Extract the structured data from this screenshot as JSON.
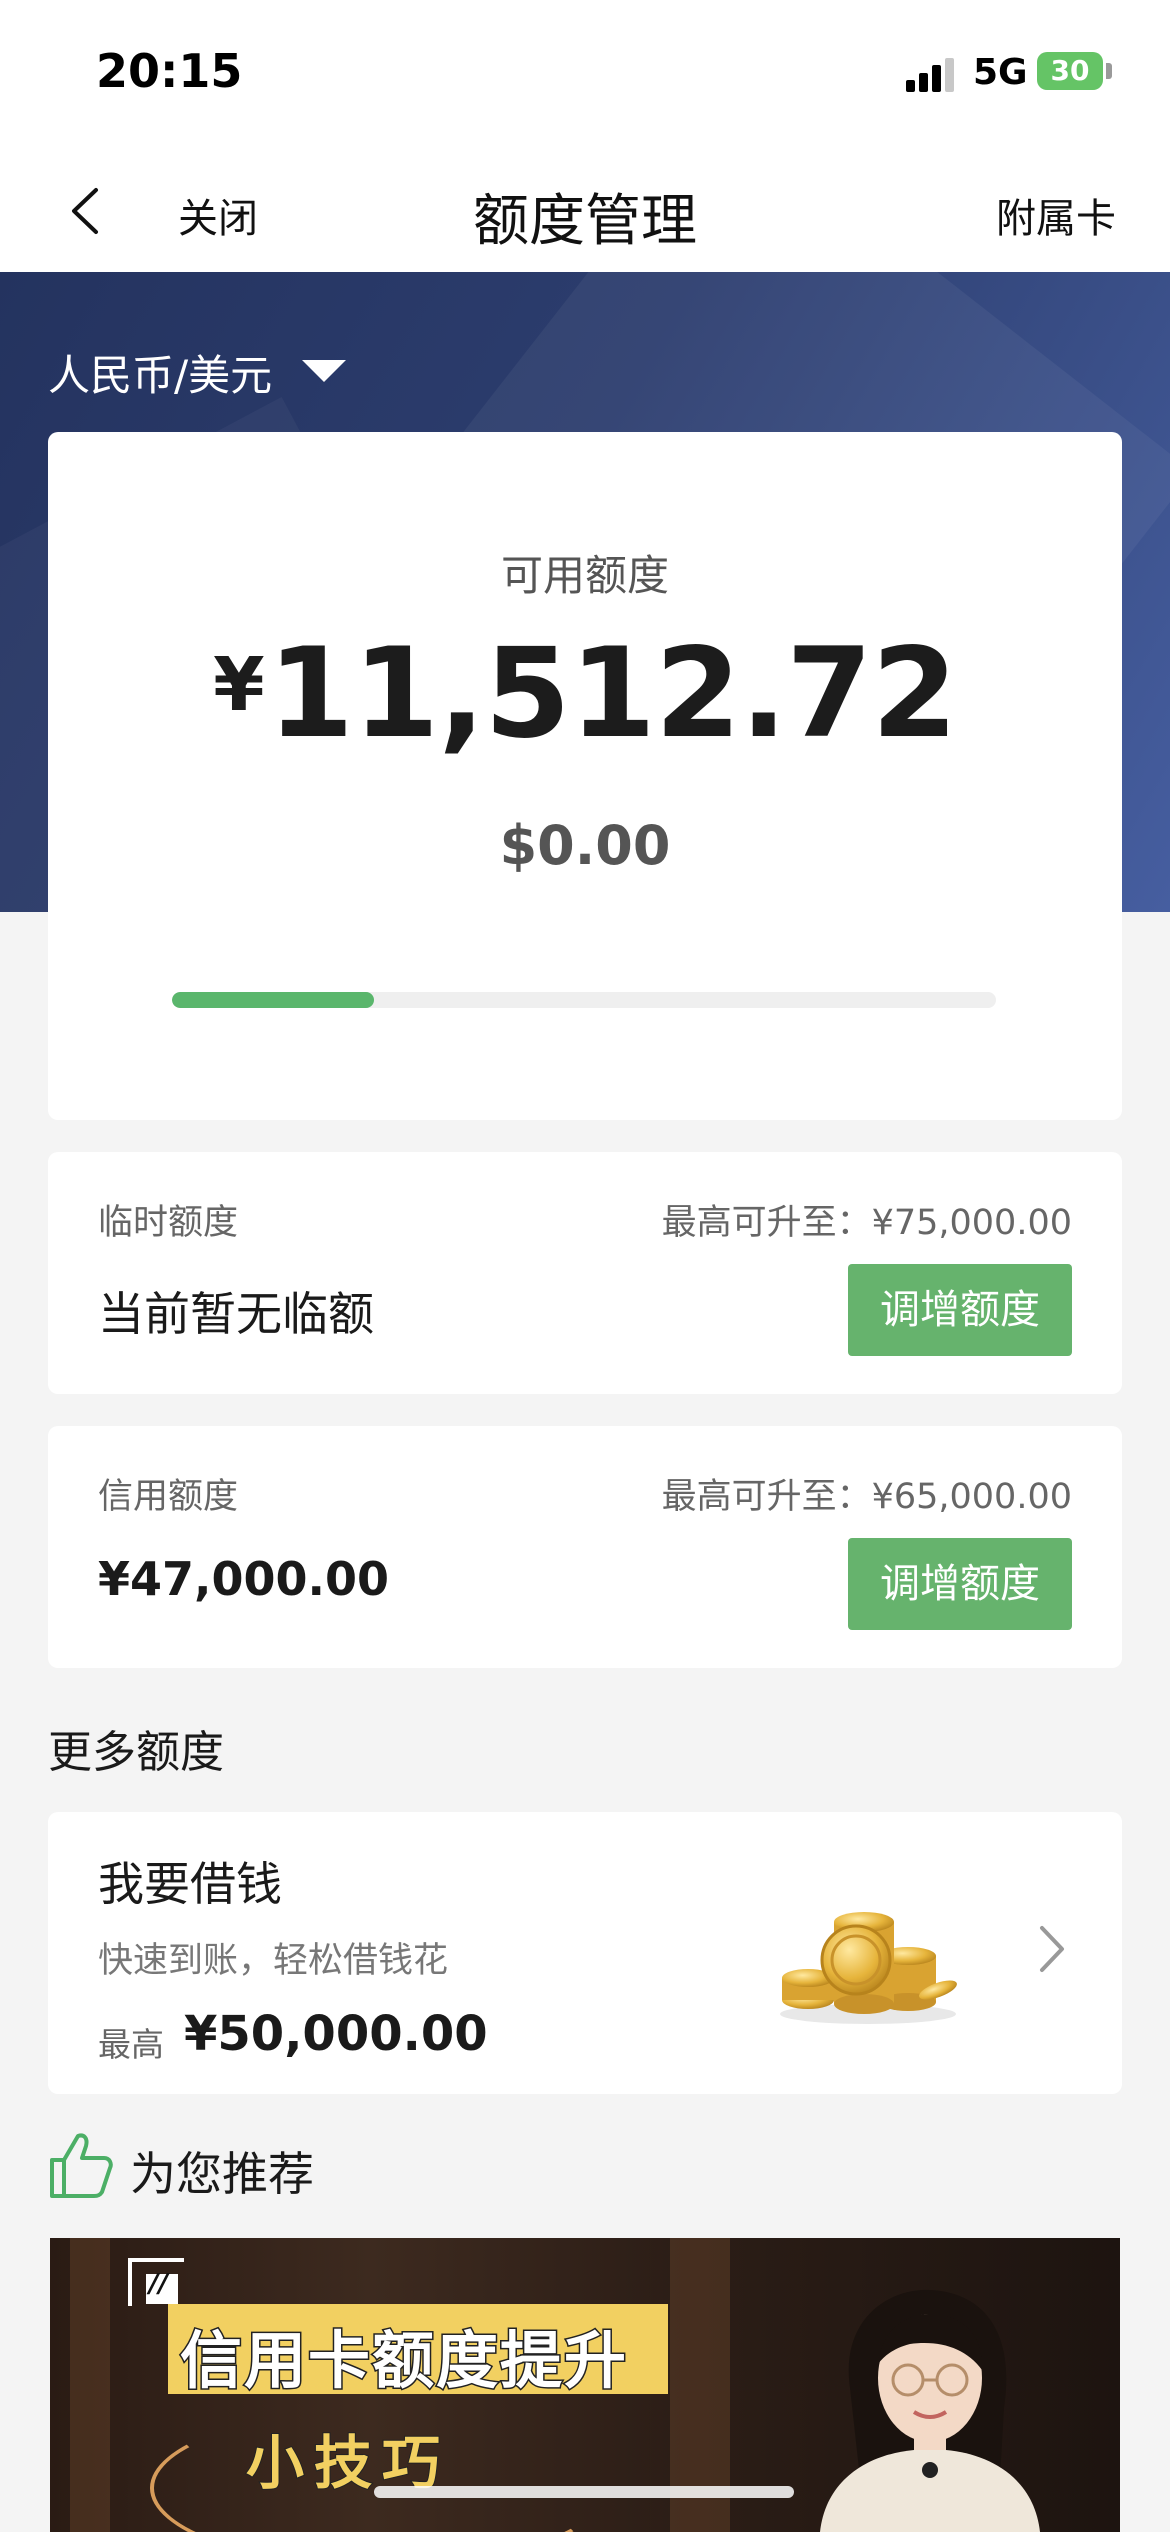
{
  "status_bar": {
    "time": "20:15",
    "network": "5G",
    "battery": "30"
  },
  "nav": {
    "close": "关闭",
    "title": "额度管理",
    "right": "附属卡"
  },
  "header": {
    "currency_selector": "人民币/美元"
  },
  "available": {
    "label": "可用额度",
    "symbol": "¥",
    "amount": "11,512.72",
    "usd": "$0.00",
    "progress_fraction": 0.245
  },
  "temp_limit": {
    "label": "临时额度",
    "max": "最高可升至：¥75,000.00",
    "value": "当前暂无临额",
    "button": "调增额度"
  },
  "credit_limit": {
    "label": "信用额度",
    "max": "最高可升至：¥65,000.00",
    "value": "¥47,000.00",
    "button": "调增额度"
  },
  "more": {
    "title": "更多额度",
    "borrow": {
      "title": "我要借钱",
      "subtitle": "快速到账，轻松借钱花",
      "max_label": "最高",
      "max_value": "¥50,000.00"
    }
  },
  "recommend": {
    "label": "为您推荐",
    "banner_title": "信用卡额度提升",
    "banner_subtitle": "小技巧"
  },
  "colors": {
    "accent_green": "#66b36d",
    "header_blue": "#2c3d6e",
    "banner_yellow": "#f2d061"
  },
  "icons": [
    "back-icon",
    "signal-icon",
    "battery-icon",
    "caret-down-icon",
    "coins-icon",
    "chevron-right-icon",
    "thumbs-up-icon",
    "video-badge-icon"
  ]
}
